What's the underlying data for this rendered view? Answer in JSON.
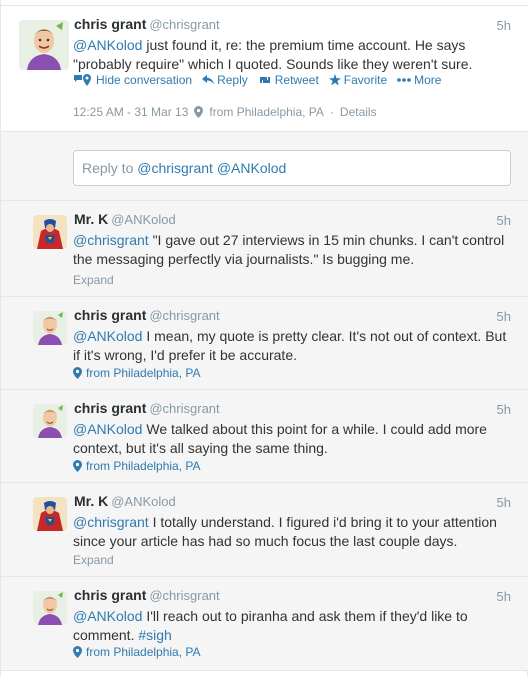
{
  "main_tweet": {
    "name": "chris grant",
    "handle": "@chrisgrant",
    "time": "5h",
    "mention": "@ANKolod",
    "text": " just found it, re: the premium time account. He says \"probably require\" which I quoted. Sounds like they weren't sure.",
    "actions": {
      "hide": "Hide conversation",
      "reply": "Reply",
      "retweet": "Retweet",
      "favorite": "Favorite",
      "more": "More"
    },
    "timestamp": "12:25 AM - 31 Mar 13",
    "location": "from Philadelphia, PA",
    "separator": "·",
    "details": "Details"
  },
  "reply": {
    "prefix": "Reply to ",
    "mentions": "@chrisgrant @ANKolod"
  },
  "tweets": [
    {
      "name": "Mr. K",
      "handle": "@ANKolod",
      "time": "5h",
      "mention": "@chrisgrant",
      "text": " \"I gave out 27 interviews in 15 min chunks. I can't control the messaging perfectly via journalists.\" Is bugging me.",
      "footer": "Expand"
    },
    {
      "name": "chris grant",
      "handle": "@chrisgrant",
      "time": "5h",
      "mention": "@ANKolod",
      "text": " I mean, my quote is pretty clear. It's not out of context. But if it's wrong, I'd prefer it be accurate.",
      "footer": "from Philadelphia, PA"
    },
    {
      "name": "chris grant",
      "handle": "@chrisgrant",
      "time": "5h",
      "mention": "@ANKolod",
      "text": " We talked about this point for a while. I could add more context, but it's all saying the same thing.",
      "footer": "from Philadelphia, PA"
    },
    {
      "name": "Mr. K",
      "handle": "@ANKolod",
      "time": "5h",
      "mention": "@chrisgrant",
      "text": " I totally understand. I figured i'd bring it to your attention since your article has had so much focus the last couple days.",
      "footer": "Expand"
    },
    {
      "name": "chris grant",
      "handle": "@chrisgrant",
      "time": "5h",
      "mention": "@ANKolod",
      "text": " I'll reach out to piranha and ask them if they'd like to comment. ",
      "hashtag": "#sigh",
      "footer": "from Philadelphia, PA"
    }
  ],
  "colors": {
    "link": "#2f7ab0",
    "muted": "#8899a6",
    "name": "#292f33",
    "background": "#f5f5f5"
  }
}
